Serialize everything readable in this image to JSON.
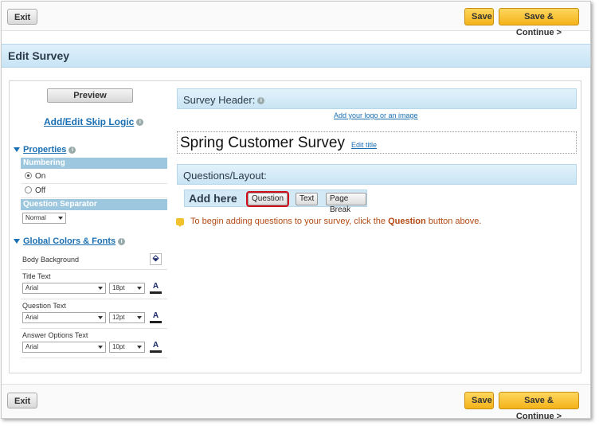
{
  "toolbar": {
    "exit_label": "Exit",
    "save_label": "Save",
    "save_continue_label": "Save & Continue >"
  },
  "page_title": "Edit Survey",
  "left": {
    "preview_label": "Preview",
    "skip_logic_label": "Add/Edit Skip Logic",
    "properties_label": "Properties",
    "numbering_header": "Numbering",
    "numbering_options": [
      "On",
      "Off"
    ],
    "numbering_selected": "On",
    "separator_header": "Question Separator",
    "separator_value": "Normal",
    "colors_label": "Global Colors & Fonts",
    "body_background_label": "Body Background",
    "font_rows": [
      {
        "label": "Title Text",
        "font": "Arial",
        "size": "18pt"
      },
      {
        "label": "Question Text",
        "font": "Arial",
        "size": "12pt"
      },
      {
        "label": "Answer Options Text",
        "font": "Arial",
        "size": "10pt"
      }
    ]
  },
  "right": {
    "survey_header_label": "Survey Header:",
    "add_logo_link": "Add your logo or an image",
    "survey_title": "Spring Customer Survey",
    "edit_title_link": "Edit title",
    "questions_layout_label": "Questions/Layout:",
    "add_here_label": "Add here",
    "add_buttons": [
      "Question",
      "Text",
      "Page Break"
    ],
    "hint_prefix": "To begin adding questions to your survey, click the ",
    "hint_bold": "Question",
    "hint_suffix": " button above."
  }
}
